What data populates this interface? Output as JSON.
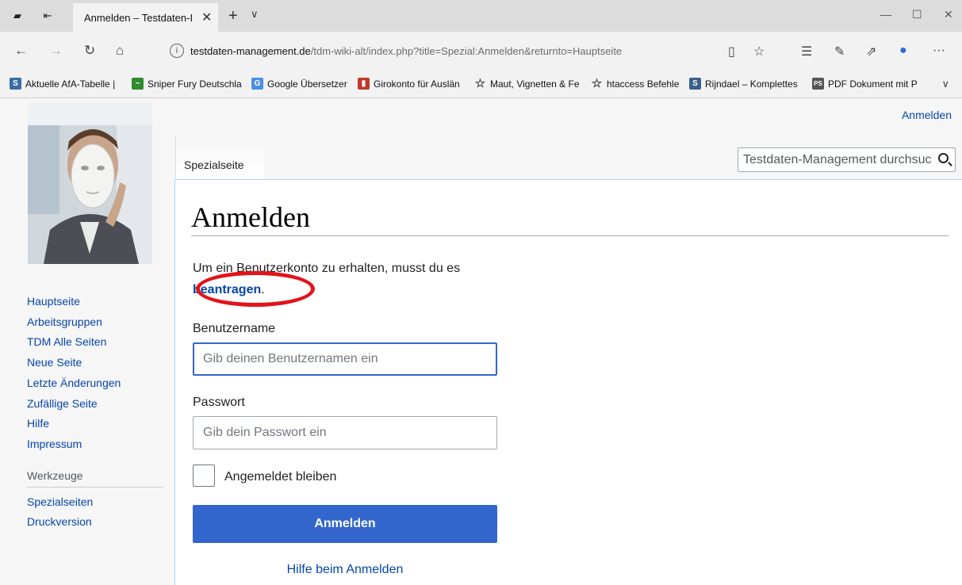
{
  "browser": {
    "tab_title": "Anmelden – Testdaten-I",
    "tab_close": "✕",
    "new_tab": "+",
    "tab_menu": "∨",
    "window_minimize": "—",
    "window_maximize": "☐",
    "window_close": "✕",
    "url_host": "testdaten-management.de",
    "url_path": "/tdm-wiki-alt/index.php?title=Spezial:Anmelden&returnto=Hauptseite",
    "bookmarks": [
      {
        "label": "Aktuelle AfA-Tabelle |",
        "icon": "S",
        "color": "#3a6ea5"
      },
      {
        "label": "Sniper Fury Deutschla",
        "icon": "~",
        "color": "#2e8b2e"
      },
      {
        "label": "Google Übersetzer",
        "icon": "G",
        "color": "#4a90e2"
      },
      {
        "label": "Girokonto für Auslän",
        "icon": "▮",
        "color": "#c0392b"
      },
      {
        "label": "Maut, Vignetten & Fe",
        "icon": "☆",
        "color": ""
      },
      {
        "label": "htaccess Befehle",
        "icon": "☆",
        "color": ""
      },
      {
        "label": "Rijndael – Komplettes",
        "icon": "S",
        "color": "#3a5f8a"
      },
      {
        "label": "PDF Dokument mit P",
        "icon": "PS",
        "color": "#555555"
      }
    ]
  },
  "header": {
    "personal_login": "Anmelden",
    "content_tab": "Spezialseite",
    "search_placeholder": "Testdaten-Management durchsuchen"
  },
  "sidebar": {
    "nav": [
      "Hauptseite",
      "Arbeitsgruppen",
      "TDM Alle Seiten",
      "Neue Seite",
      "Letzte Änderungen",
      "Zufällige Seite",
      "Hilfe",
      "Impressum"
    ],
    "tools_heading": "Werkzeuge",
    "tools": [
      "Spezialseiten",
      "Druckversion"
    ]
  },
  "main": {
    "title": "Anmelden",
    "intro_before": "Um ein Benutzerkonto zu erhalten, musst du es ",
    "intro_link": "beantragen",
    "intro_after": ".",
    "username_label": "Benutzername",
    "username_placeholder": "Gib deinen Benutzernamen ein",
    "password_label": "Passwort",
    "password_placeholder": "Gib dein Passwort ein",
    "remember_label": "Angemeldet bleiben",
    "submit_label": "Anmelden",
    "help_link": "Hilfe beim Anmelden"
  },
  "colors": {
    "link": "#0645ad",
    "button": "#3366cc",
    "highlight_ring": "#e3131b"
  }
}
